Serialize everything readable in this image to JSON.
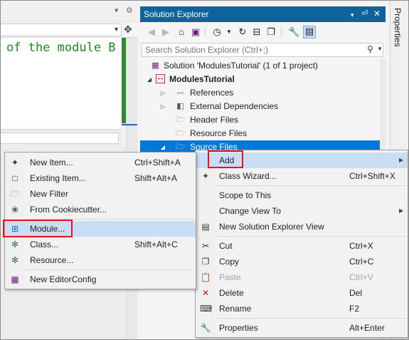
{
  "editor": {
    "pin_glyph": "▾",
    "gear_glyph": "⚙",
    "code_text": "of the module B"
  },
  "solution_explorer": {
    "title": "Solution Explorer",
    "title_controls": [
      "▾",
      "📌",
      "✕"
    ],
    "search_placeholder": "Search Solution Explorer (Ctrl+;)",
    "tree": [
      {
        "label": "Solution 'ModulesTutorial' (1 of 1 project)",
        "icon": "solution-icon"
      },
      {
        "label": "ModulesTutorial",
        "icon": "cpp-project-icon"
      },
      {
        "label": "References",
        "icon": "references-icon"
      },
      {
        "label": "External Dependencies",
        "icon": "external-dependencies-icon"
      },
      {
        "label": "Header Files",
        "icon": "filter-folder-icon"
      },
      {
        "label": "Resource Files",
        "icon": "filter-folder-icon"
      },
      {
        "label": "Source Files",
        "icon": "filter-folder-icon"
      }
    ]
  },
  "properties_tab": {
    "label": "Properties"
  },
  "context_menu": {
    "items": [
      {
        "label": "Add",
        "shortcut": "",
        "icon": ""
      },
      {
        "label": "Class Wizard...",
        "shortcut": "Ctrl+Shift+X",
        "icon": "class-wizard-icon"
      },
      {
        "label": "Scope to This",
        "shortcut": "",
        "icon": ""
      },
      {
        "label": "Change View To",
        "shortcut": "",
        "icon": ""
      },
      {
        "label": "New Solution Explorer View",
        "shortcut": "",
        "icon": "new-view-icon"
      },
      {
        "label": "Cut",
        "shortcut": "Ctrl+X",
        "icon": "cut-icon"
      },
      {
        "label": "Copy",
        "shortcut": "Ctrl+C",
        "icon": "copy-icon"
      },
      {
        "label": "Paste",
        "shortcut": "Ctrl+V",
        "icon": "paste-icon"
      },
      {
        "label": "Delete",
        "shortcut": "Del",
        "icon": "delete-icon"
      },
      {
        "label": "Rename",
        "shortcut": "F2",
        "icon": "rename-icon"
      },
      {
        "label": "Properties",
        "shortcut": "Alt+Enter",
        "icon": "wrench-icon"
      }
    ]
  },
  "add_submenu": {
    "items": [
      {
        "label": "New Item...",
        "shortcut": "Ctrl+Shift+A",
        "icon": "new-item-icon"
      },
      {
        "label": "Existing Item...",
        "shortcut": "Shift+Alt+A",
        "icon": "existing-item-icon"
      },
      {
        "label": "New Filter",
        "shortcut": "",
        "icon": "new-filter-icon"
      },
      {
        "label": "From Cookiecutter...",
        "shortcut": "",
        "icon": "cookiecutter-icon"
      },
      {
        "label": "Module...",
        "shortcut": "",
        "icon": "module-icon"
      },
      {
        "label": "Class...",
        "shortcut": "Shift+Alt+C",
        "icon": "class-icon"
      },
      {
        "label": "Resource...",
        "shortcut": "",
        "icon": "resource-icon"
      },
      {
        "label": "New EditorConfig",
        "shortcut": "",
        "icon": "editorconfig-icon"
      }
    ]
  },
  "colors": {
    "title_bar": "#0e639c",
    "selection": "#0078d7",
    "menu_highlight": "#c9def5",
    "callout_red": "#e81123",
    "code_green": "#1e8a1e"
  }
}
